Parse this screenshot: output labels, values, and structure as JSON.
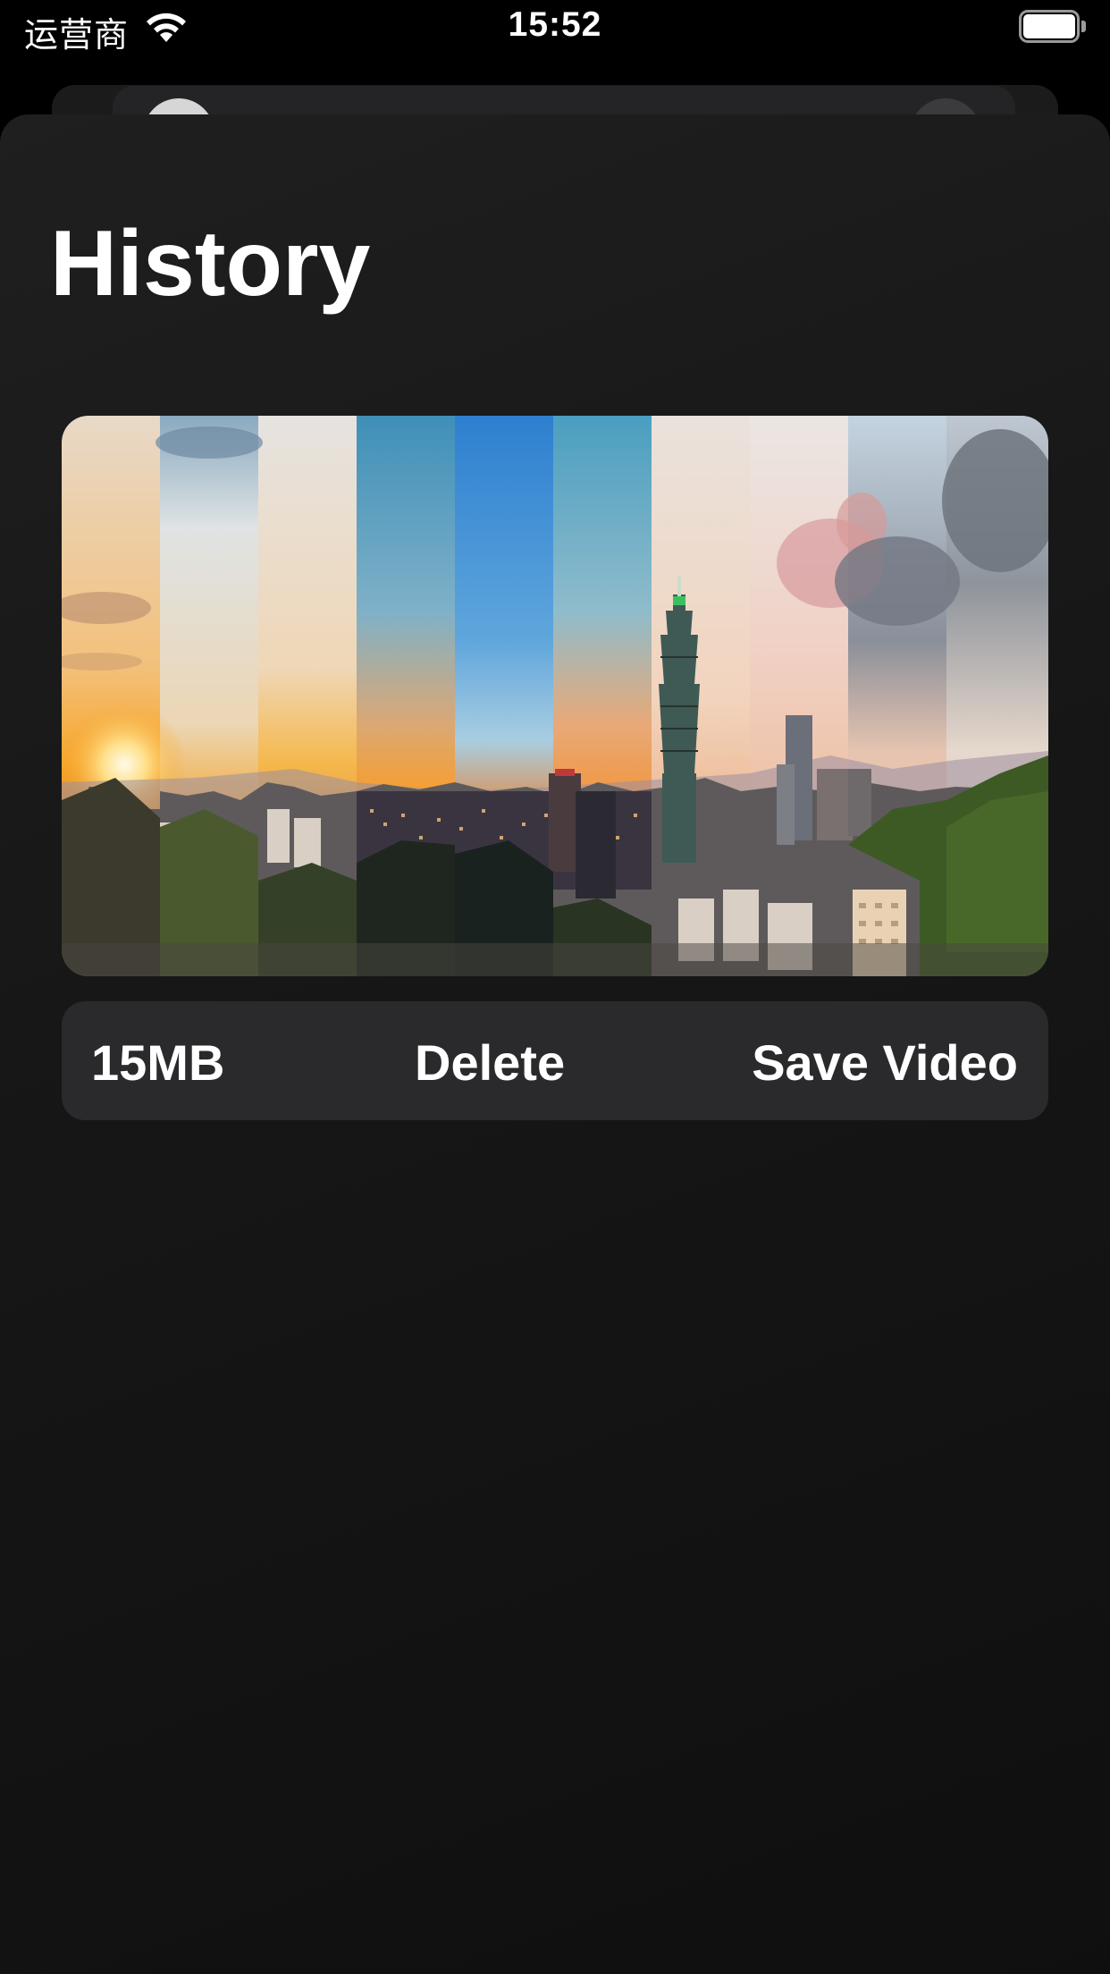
{
  "status_bar": {
    "carrier": "运营商",
    "time": "15:52",
    "wifi_icon": "wifi-icon",
    "battery_icon": "battery-icon",
    "battery_level": 1.0
  },
  "page": {
    "title": "History"
  },
  "history_items": [
    {
      "thumbnail": "city-skyline-timelapse-thumbnail",
      "size": "15MB",
      "delete_label": "Delete",
      "save_label": "Save Video"
    }
  ],
  "colors": {
    "background": "#000000",
    "sheet": "#1a1a1a",
    "action_bar": "#2a2a2c",
    "text": "#ffffff"
  }
}
